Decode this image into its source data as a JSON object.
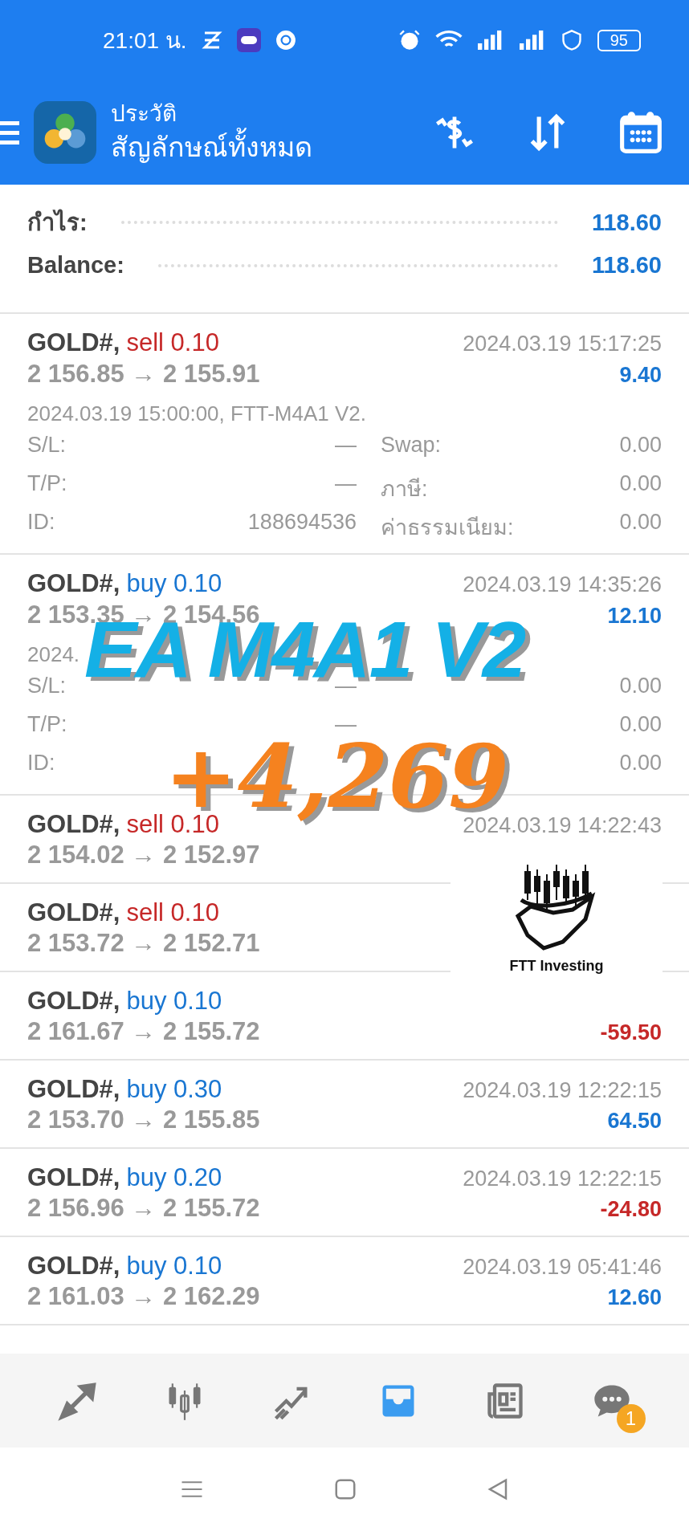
{
  "status_bar": {
    "time": "21:01 น.",
    "battery": "95"
  },
  "header": {
    "title": "ประวัติ",
    "subtitle": "สัญลักษณ์ทั้งหมด"
  },
  "summary": [
    {
      "label": "กำไร:",
      "value": "118.60"
    },
    {
      "label": "Balance:",
      "value": "118.60"
    }
  ],
  "trades": [
    {
      "symbol": "GOLD#,",
      "side": "sell",
      "volume": "0.10",
      "prices": "2 156.85 → 2 155.91",
      "time": "2024.03.19 15:17:25",
      "profit": "9.40",
      "loss": false,
      "details": {
        "comment": "2024.03.19 15:00:00, FTT-M4A1 V2.",
        "fields": [
          {
            "label": "S/L:",
            "value": "—"
          },
          {
            "label": "Swap:",
            "value": "0.00"
          },
          {
            "label": "T/P:",
            "value": "—"
          },
          {
            "label": "ภาษี:",
            "value": "0.00"
          },
          {
            "label": "ID:",
            "value": "188694536"
          },
          {
            "label": "ค่าธรรมเนียม:",
            "value": "0.00"
          }
        ]
      }
    },
    {
      "symbol": "GOLD#,",
      "side": "buy",
      "volume": "0.10",
      "prices": "2 153.35 → 2 154.56",
      "time": "2024.03.19 14:35:26",
      "profit": "12.10",
      "loss": false,
      "details": {
        "comment": "2024.",
        "fields": [
          {
            "label": "S/L:",
            "value": "—"
          },
          {
            "value": "0.00"
          },
          {
            "label": "T/P:",
            "value": "—"
          },
          {
            "value": "0.00"
          },
          {
            "label": "ID:"
          },
          {
            "value": "0.00"
          }
        ]
      }
    },
    {
      "symbol": "GOLD#,",
      "side": "sell",
      "volume": "0.10",
      "prices": "2 154.02 → 2 152.97",
      "time": "2024.03.19 14:22:43"
    },
    {
      "symbol": "GOLD#,",
      "side": "sell",
      "volume": "0.10",
      "prices": "2 153.72 → 2 152.71"
    },
    {
      "symbol": "GOLD#,",
      "side": "buy",
      "volume": "0.10",
      "prices": "2 161.67 → 2 155.72",
      "profit": "-59.50",
      "loss": true
    },
    {
      "symbol": "GOLD#,",
      "side": "buy",
      "volume": "0.30",
      "prices": "2 153.70 → 2 155.85",
      "time": "2024.03.19 12:22:15",
      "profit": "64.50",
      "loss": false
    },
    {
      "symbol": "GOLD#,",
      "side": "buy",
      "volume": "0.20",
      "prices": "2 156.96 → 2 155.72",
      "time": "2024.03.19 12:22:15",
      "profit": "-24.80",
      "loss": true
    },
    {
      "symbol": "GOLD#,",
      "side": "buy",
      "volume": "0.10",
      "prices": "2 161.03 → 2 162.29",
      "time": "2024.03.19 05:41:46",
      "profit": "12.60",
      "loss": false
    }
  ],
  "overlay": {
    "headline": "EA M4A1 V2",
    "figure": "+4,269",
    "logo_text": "FTT Investing"
  },
  "bottom_nav": [
    {
      "selected": false
    },
    {
      "selected": false
    },
    {
      "selected": false
    },
    {
      "selected": true
    },
    {
      "selected": false
    },
    {
      "selected": false,
      "badge": "1"
    }
  ]
}
